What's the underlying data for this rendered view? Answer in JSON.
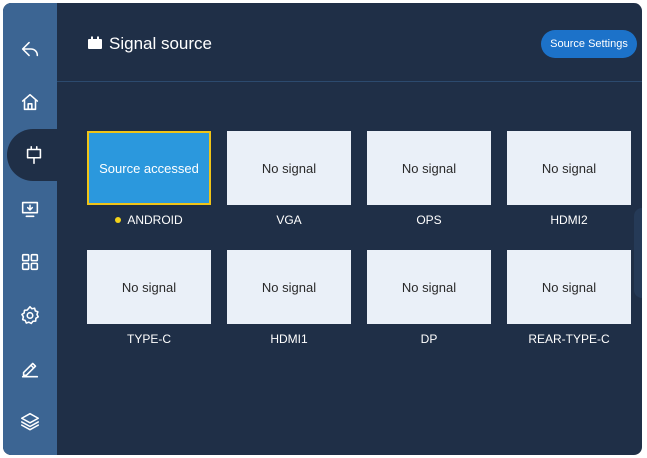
{
  "header": {
    "title": "Signal source",
    "settings_label": "Source Settings"
  },
  "sidebar": {
    "items": [
      {
        "name": "back-icon"
      },
      {
        "name": "home-icon"
      },
      {
        "name": "signal-source-icon",
        "active": true
      },
      {
        "name": "screen-cast-icon"
      },
      {
        "name": "apps-grid-icon"
      },
      {
        "name": "gear-icon"
      },
      {
        "name": "pen-icon"
      },
      {
        "name": "layers-icon"
      }
    ]
  },
  "sources": [
    {
      "status": "Source accessed",
      "label": "ANDROID",
      "selected": true
    },
    {
      "status": "No signal",
      "label": "VGA"
    },
    {
      "status": "No signal",
      "label": "OPS"
    },
    {
      "status": "No signal",
      "label": "HDMI2"
    },
    {
      "status": "No signal",
      "label": "TYPE-C"
    },
    {
      "status": "No signal",
      "label": "HDMI1"
    },
    {
      "status": "No signal",
      "label": "DP"
    },
    {
      "status": "No signal",
      "label": "REAR-TYPE-C"
    }
  ],
  "colors": {
    "background": "#1f2f47",
    "sidebar": "#3c6593",
    "card": "#eaf0f8",
    "card_selected": "#2b98dd",
    "selected_border": "#f0c417",
    "accent_button": "#1c72c9",
    "active_dot": "#f2d21a"
  }
}
